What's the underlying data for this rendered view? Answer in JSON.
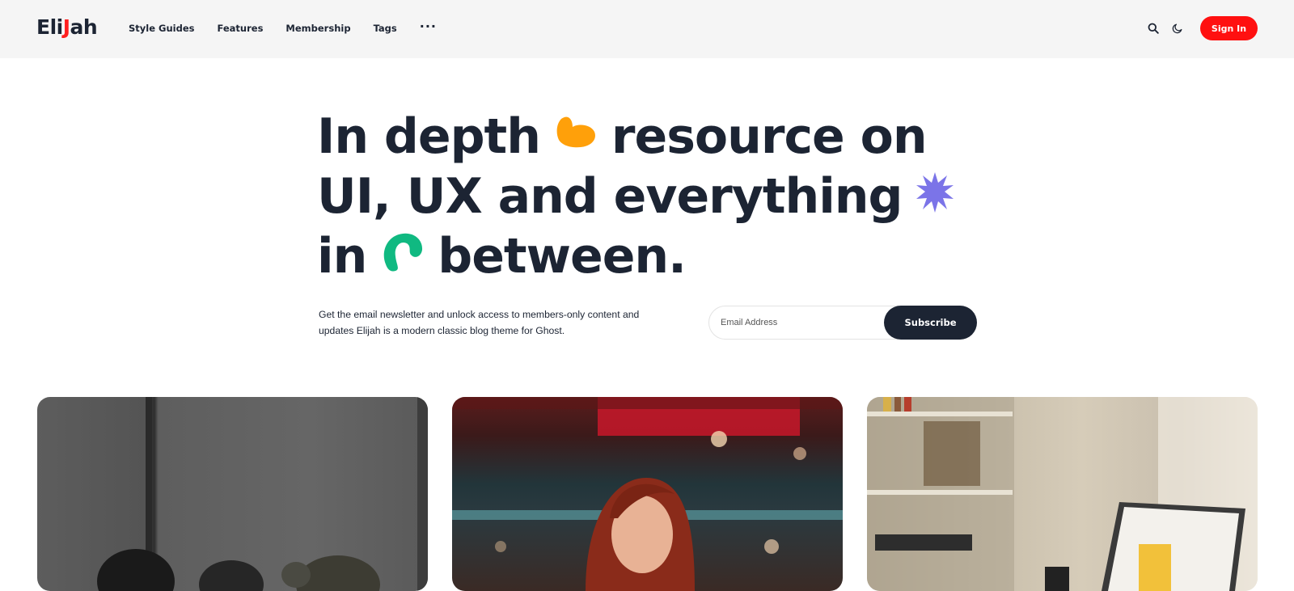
{
  "header": {
    "logo_text_part1": "Eli",
    "logo_text_accent": "J",
    "logo_text_part2": "ah",
    "nav": [
      "Style Guides",
      "Features",
      "Membership",
      "Tags"
    ],
    "more_icon": "more-horizontal-icon",
    "search_icon": "search-icon",
    "theme_icon": "moon-icon",
    "signin_label": "Sign In"
  },
  "hero": {
    "line1_a": "In depth",
    "line1_b": "resource on",
    "line2": "UI, UX and everything",
    "line3_a": "in",
    "line3_b": "between.",
    "decorations": [
      "orange-heart-shape",
      "purple-star-shape",
      "green-swirl-shape"
    ]
  },
  "newsletter": {
    "description": "Get the email newsletter and unlock access to members-only content and updates Elijah is a modern classic blog theme for Ghost.",
    "email_placeholder": "Email Address",
    "subscribe_label": "Subscribe"
  },
  "colors": {
    "brand_red": "#ff1010",
    "dark": "#1c2433",
    "orange": "#ffa00a",
    "purple": "#7b74e8",
    "green": "#10b981"
  },
  "cards": [
    {
      "image": "people-with-headphones-photo"
    },
    {
      "image": "smiling-redhead-woman-neon-photo"
    },
    {
      "image": "desk-laptop-newsletter-photo"
    }
  ]
}
